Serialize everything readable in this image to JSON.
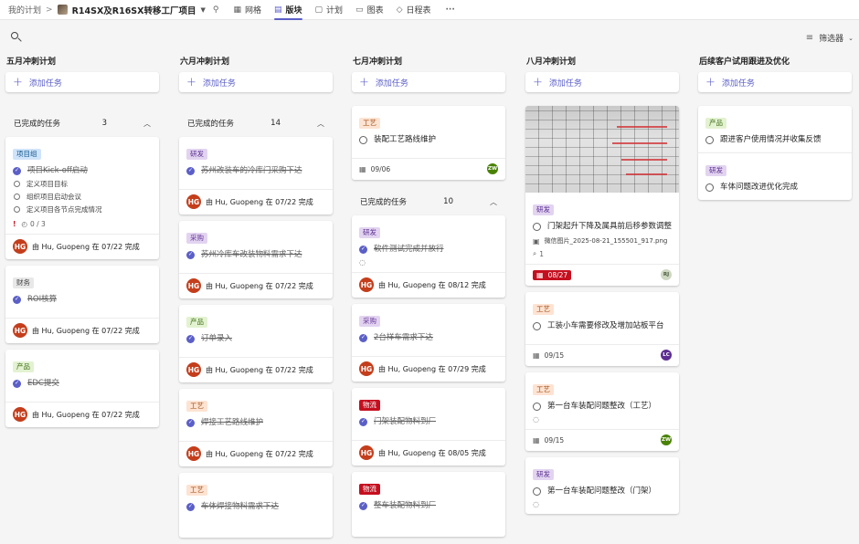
{
  "topbar": {
    "breadcrumb": "我的计划",
    "separator": ">",
    "plan_title": "R14SX及R16SX转移工厂项目",
    "tabs": [
      {
        "label": "网格",
        "icon": "grid-icon"
      },
      {
        "label": "版块",
        "icon": "board-icon",
        "active": true
      },
      {
        "label": "计划",
        "icon": "schedule-icon"
      },
      {
        "label": "图表",
        "icon": "chart-icon"
      },
      {
        "label": "日程表",
        "icon": "timeline-icon"
      }
    ],
    "more": "···"
  },
  "toolbar": {
    "filter_label": "筛选器"
  },
  "add_task": "添加任务",
  "columns": [
    {
      "title": "五月冲刺计划",
      "group": {
        "label": "已完成的任务",
        "count": "3"
      },
      "cards": [
        {
          "tag": "项目组",
          "title": "项目Kick-off启动",
          "subtasks": [
            "定义项目目标",
            "组织项目启动会议",
            "定义项目各节点完成情况"
          ],
          "checklist": "0 / 3",
          "priority": "!",
          "completed_by": "由 Hu, Guopeng 在 07/22 完成"
        },
        {
          "tag": "财务",
          "title": "ROI核算",
          "completed_by": "由 Hu, Guopeng 在 07/22 完成"
        },
        {
          "tag": "产品",
          "title": "EDC提交",
          "completed_by": "由 Hu, Guopeng 在 07/22 完成"
        }
      ]
    },
    {
      "title": "六月冲刺计划",
      "group": {
        "label": "已完成的任务",
        "count": "14"
      },
      "cards": [
        {
          "tag": "研发",
          "title": "苏州改装车的冷库门采购下达",
          "completed_by": "由 Hu, Guopeng 在 07/22 完成"
        },
        {
          "tag": "采购",
          "title": "苏州冷库车改装物料需求下达",
          "completed_by": "由 Hu, Guopeng 在 07/22 完成"
        },
        {
          "tag": "产品",
          "title": "订单录入",
          "completed_by": "由 Hu, Guopeng 在 07/22 完成"
        },
        {
          "tag": "工艺",
          "title": "焊接工艺路线维护",
          "completed_by": "由 Hu, Guopeng 在 07/22 完成"
        },
        {
          "tag": "工艺",
          "title": "车体焊接物料需求下达"
        }
      ]
    },
    {
      "title": "七月冲刺计划",
      "open_card": {
        "tag": "工艺",
        "title": "装配工艺路线维护",
        "date": "09/06",
        "assignee": "ZW"
      },
      "group": {
        "label": "已完成的任务",
        "count": "10"
      },
      "cards": [
        {
          "tag": "研发",
          "title": "软件测试完成并放行",
          "completed_by": "由 Hu, Guopeng 在 08/12 完成"
        },
        {
          "tag": "采购",
          "title": "2台样车需求下达",
          "completed_by": "由 Hu, Guopeng 在 07/29 完成"
        },
        {
          "tag": "物流",
          "title": "门架装配物料到厂",
          "completed_by": "由 Hu, Guopeng 在 08/05 完成"
        },
        {
          "tag": "物流",
          "title": "整车装配物料到厂"
        }
      ]
    },
    {
      "title": "八月冲刺计划",
      "cards": [
        {
          "tag": "研发",
          "title": "门架起升下降及属具前后移参数调整",
          "attachment": "微信图片_2025-08-21_155501_917.png",
          "attach_count": "1",
          "date": "08/27",
          "assignee": "RJ"
        },
        {
          "tag": "工艺",
          "title": "工装小车需要修改及增加站板平台",
          "date": "09/15",
          "assignee": "LC"
        },
        {
          "tag": "工艺",
          "title": "第一台车装配问题整改（工艺）",
          "date": "09/15",
          "assignee": "ZW"
        },
        {
          "tag": "研发",
          "title": "第一台车装配问题整改（门架）"
        }
      ]
    },
    {
      "title": "后续客户试用跟进及优化",
      "cards": [
        {
          "tag": "产品",
          "title": "跟进客户使用情况并收集反馈"
        },
        {
          "tag": "研发",
          "title": "车体问题改进优化完成"
        }
      ]
    }
  ],
  "avatar_initials": "HG",
  "colors": {
    "accent": "#5b5fc7",
    "late": "#c50f1f"
  }
}
